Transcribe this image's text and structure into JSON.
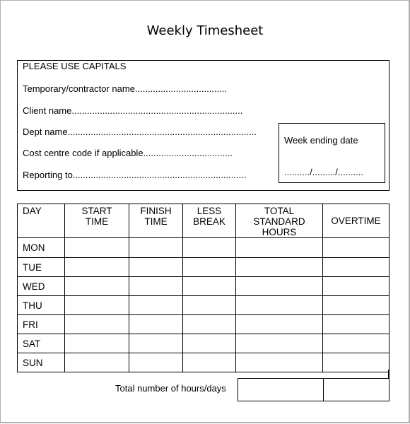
{
  "document": {
    "title": "Weekly Timesheet"
  },
  "info": {
    "instruction": "PLEASE USE CAPITALS",
    "fields": [
      {
        "label": "Temporary/contractor name",
        "dots": "....................................",
        "value": ""
      },
      {
        "label": "Client name",
        "dots": "...................................................................",
        "value": ""
      },
      {
        "label": "Dept name",
        "dots": "..........................................................................",
        "value": ""
      },
      {
        "label": "Cost centre code if applicable",
        "dots": "...................................",
        "value": ""
      },
      {
        "label": "Reporting to",
        "dots": "....................................................................",
        "value": ""
      }
    ],
    "week_ending": {
      "label": "Week ending date",
      "placeholder": "........../........./.........."
    }
  },
  "timesheet": {
    "headers": [
      [
        "DAY"
      ],
      [
        "START",
        "TIME"
      ],
      [
        "FINISH",
        "TIME"
      ],
      [
        "LESS",
        "BREAK"
      ],
      [
        "TOTAL",
        "STANDARD",
        "HOURS"
      ],
      [
        "OVERTIME"
      ]
    ],
    "rows": [
      {
        "day": "MON",
        "start": "",
        "finish": "",
        "break": "",
        "standard": "",
        "overtime": ""
      },
      {
        "day": "TUE",
        "start": "",
        "finish": "",
        "break": "",
        "standard": "",
        "overtime": ""
      },
      {
        "day": "WED",
        "start": "",
        "finish": "",
        "break": "",
        "standard": "",
        "overtime": ""
      },
      {
        "day": "THU",
        "start": "",
        "finish": "",
        "break": "",
        "standard": "",
        "overtime": ""
      },
      {
        "day": "FRI",
        "start": "",
        "finish": "",
        "break": "",
        "standard": "",
        "overtime": ""
      },
      {
        "day": "SAT",
        "start": "",
        "finish": "",
        "break": "",
        "standard": "",
        "overtime": ""
      },
      {
        "day": "SUN",
        "start": "",
        "finish": "",
        "break": "",
        "standard": "",
        "overtime": ""
      }
    ],
    "totals": {
      "label": "Total number of hours/days",
      "standard": "",
      "overtime": ""
    }
  }
}
